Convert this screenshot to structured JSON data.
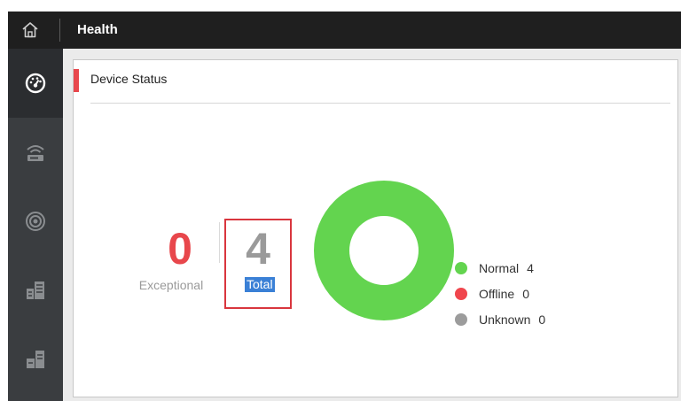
{
  "header": {
    "title": "Health",
    "home_icon": "home-icon"
  },
  "sidebar": {
    "items": [
      {
        "icon": "dashboard-gauge-icon",
        "active": true
      },
      {
        "icon": "network-device-icon",
        "active": false
      },
      {
        "icon": "camera-icon",
        "active": false
      },
      {
        "icon": "storage-server-icon",
        "active": false
      },
      {
        "icon": "encoding-server-icon",
        "active": false
      }
    ]
  },
  "device_status": {
    "title": "Device Status",
    "exceptional": {
      "value": "0",
      "label": "Exceptional"
    },
    "total": {
      "value": "4",
      "label": "Total"
    },
    "legend": [
      {
        "name": "Normal",
        "count": "4",
        "color": "#63d44f"
      },
      {
        "name": "Offline",
        "count": "0",
        "color": "#f0464d"
      },
      {
        "name": "Unknown",
        "count": "0",
        "color": "#9c9c9c"
      }
    ]
  },
  "colors": {
    "accent_red": "#e8474c",
    "normal_green": "#63d44f",
    "selection_blue": "#3a80d6"
  }
}
